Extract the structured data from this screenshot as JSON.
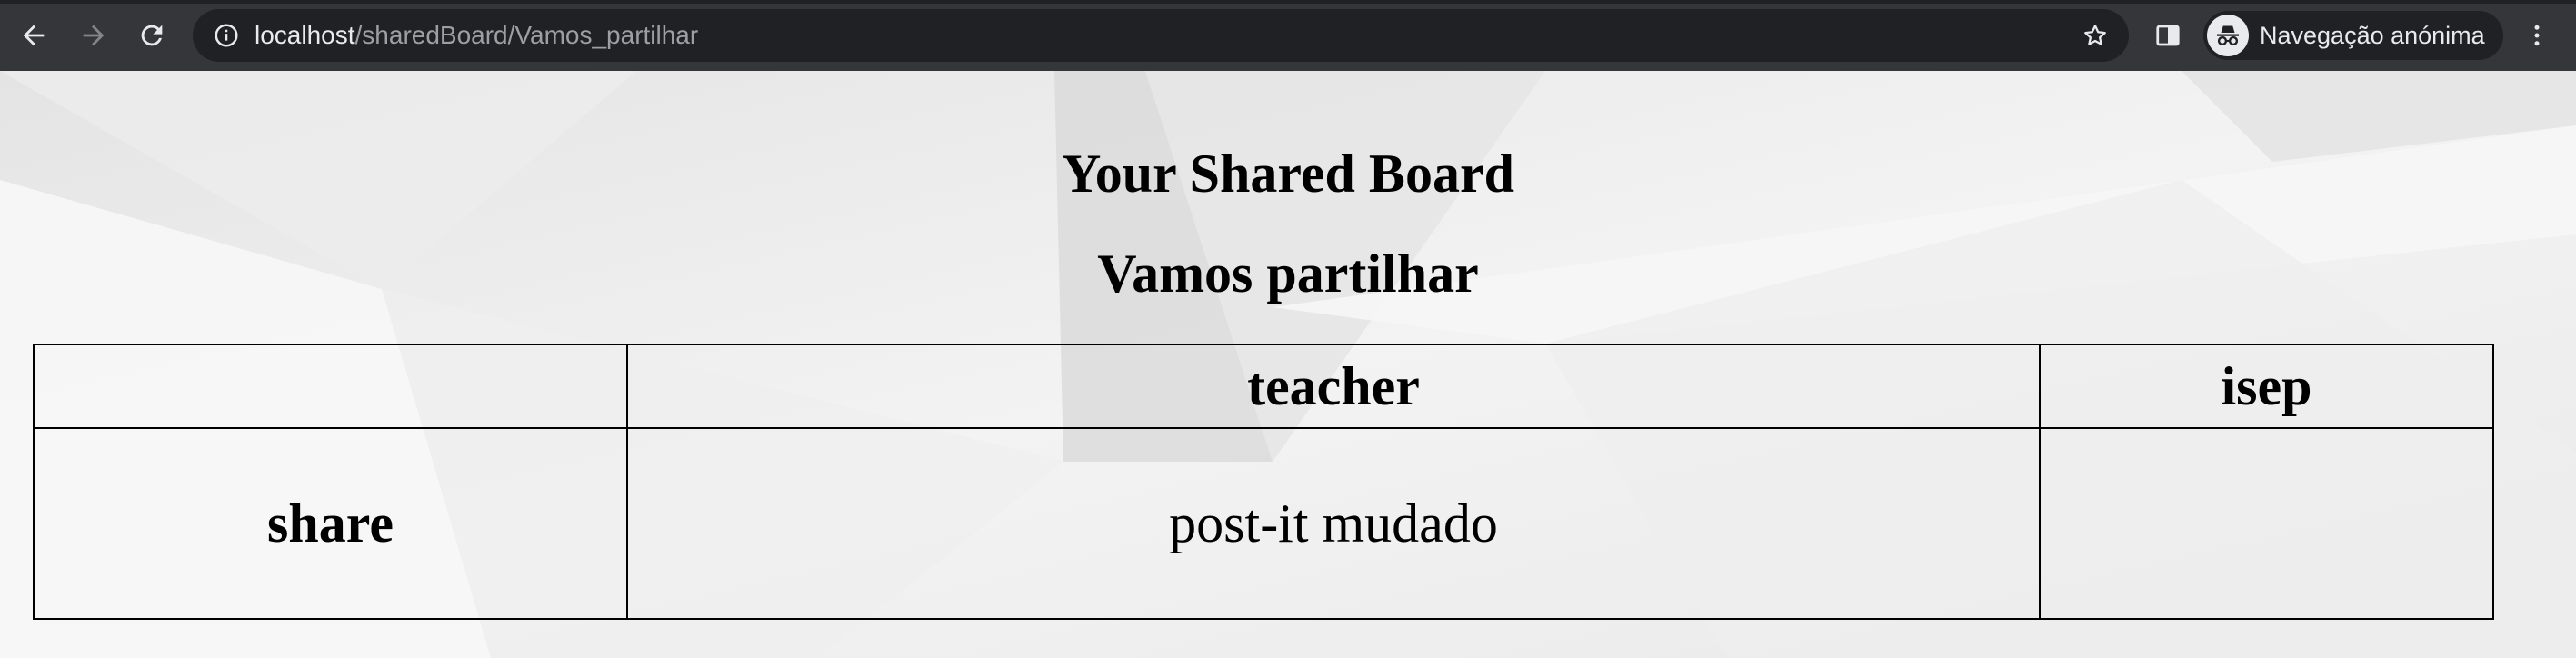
{
  "browser": {
    "url_host": "localhost",
    "url_path": "/sharedBoard/Vamos_partilhar",
    "profile_label": "Navegação anónima",
    "icons": {
      "back": "back-arrow-icon",
      "forward": "forward-arrow-icon",
      "reload": "reload-icon",
      "site_info": "info-icon",
      "bookmark": "star-icon",
      "side_panel": "side-panel-icon",
      "incognito": "incognito-icon",
      "menu": "kebab-menu-icon"
    },
    "colors": {
      "chrome_bg": "#35363a",
      "omnibox_bg": "#202124",
      "text": "#e8eaed",
      "muted": "#9aa0a6"
    }
  },
  "page": {
    "title": "Your Shared Board",
    "board_name": "Vamos partilhar",
    "table": {
      "columns": [
        "",
        "teacher",
        "isep"
      ],
      "rows": [
        {
          "header": "share",
          "cells": [
            "post-it mudado",
            ""
          ]
        }
      ]
    }
  }
}
